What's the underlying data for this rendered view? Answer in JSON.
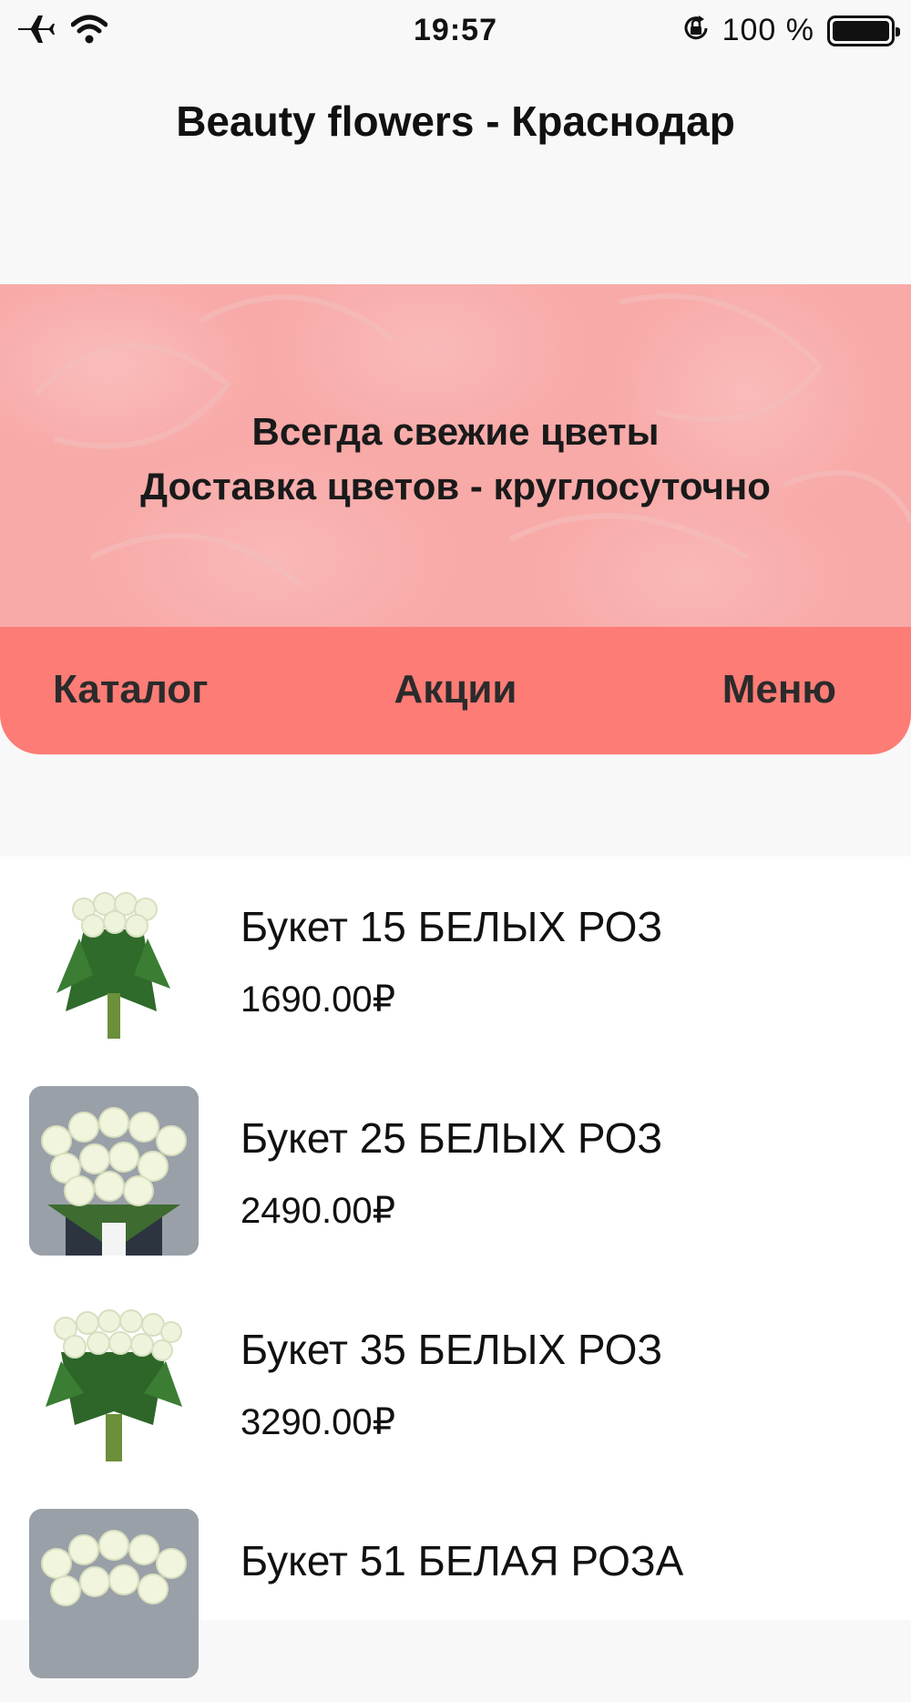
{
  "status_bar": {
    "time": "19:57",
    "battery_percent": "100 %",
    "battery_level": 1.0,
    "icons": [
      "airplane-icon",
      "wifi-icon",
      "orientation-lock-icon",
      "battery-icon"
    ]
  },
  "app": {
    "title": "Beauty flowers - Краснодар"
  },
  "hero": {
    "line1": "Всегда свежие цветы",
    "line2": "Доставка цветов - круглосуточно"
  },
  "nav": {
    "catalog": "Каталог",
    "promotions": "Акции",
    "menu": "Меню"
  },
  "colors": {
    "background": "#f8f8f8",
    "hero": "#f8aaa8",
    "nav": "#fd7c76",
    "list_background": "#ffffff"
  },
  "products": [
    {
      "title": "Букет 15 БЕЛЫХ РОЗ",
      "price": "1690.00₽"
    },
    {
      "title": "Букет 25 БЕЛЫХ РОЗ",
      "price": "2490.00₽"
    },
    {
      "title": "Букет 35 БЕЛЫХ РОЗ",
      "price": "3290.00₽"
    },
    {
      "title": "Букет 51 БЕЛАЯ РОЗА",
      "price": ""
    }
  ]
}
